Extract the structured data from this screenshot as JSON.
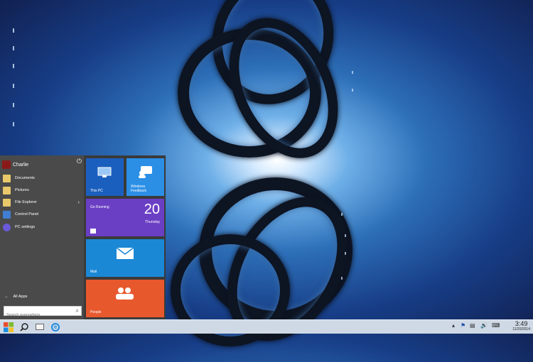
{
  "start_menu": {
    "user_name": "Charlie",
    "power_icon": "power-icon",
    "items": [
      {
        "label": "Documents",
        "icon": "folder-icon"
      },
      {
        "label": "Pictures",
        "icon": "folder-icon"
      },
      {
        "label": "File Explorer",
        "icon": "folder-icon"
      },
      {
        "label": "Control Panel",
        "icon": "control-panel-icon"
      },
      {
        "label": "PC settings",
        "icon": "gear-icon"
      }
    ],
    "all_apps_label": "All Apps",
    "search_placeholder": "Search everywhere"
  },
  "tiles": {
    "this_pc": "This PC",
    "windows_feedback": "Windows Feedback",
    "go_running": "Go Running",
    "date_number": "20",
    "date_day": "Thursday",
    "mail": "Mail",
    "people": "People"
  },
  "taskbar": {
    "time": "3:49",
    "date": "11/20/2014"
  },
  "colors": {
    "tile_blue": "#1b5fbe",
    "tile_light_blue": "#2b8fe6",
    "tile_purple": "#6a3fc4",
    "tile_mail": "#1b88d6",
    "tile_people": "#e8582d"
  }
}
